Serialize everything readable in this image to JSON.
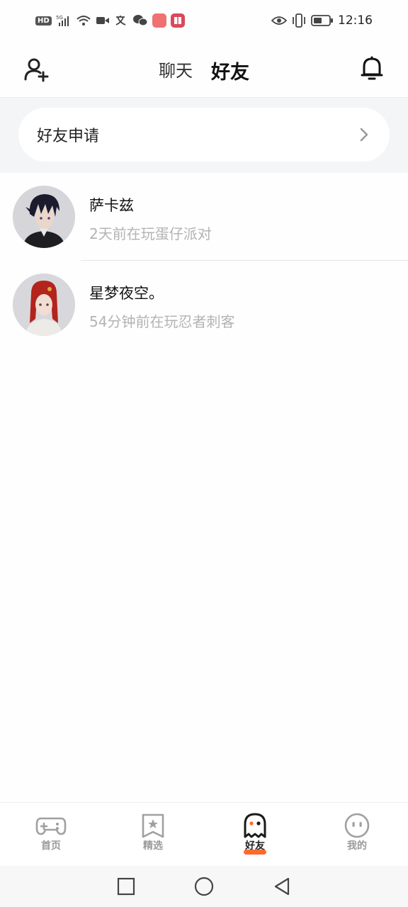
{
  "status_bar": {
    "hd": "HD",
    "signal": "5G",
    "time": "12:16",
    "icons": [
      "hd-icon",
      "signal-icon",
      "wifi-icon",
      "video-icon",
      "translate-icon",
      "wechat-icon",
      "app-icon-red",
      "app-icon-book",
      "eye-icon",
      "vibrate-icon",
      "battery-icon"
    ]
  },
  "header": {
    "tabs": [
      {
        "label": "聊天",
        "active": false
      },
      {
        "label": "好友",
        "active": true
      }
    ],
    "accent": "#ff5a1f"
  },
  "friend_request": {
    "label": "好友申请"
  },
  "friends": [
    {
      "name": "萨卡兹",
      "status": "2天前在玩蛋仔派对"
    },
    {
      "name": "星梦夜空。",
      "status": "54分钟前在玩忍者刺客"
    }
  ],
  "bottom_nav": {
    "items": [
      {
        "label": "首页",
        "icon": "gamepad-icon",
        "active": false
      },
      {
        "label": "精选",
        "icon": "star-bookmark-icon",
        "active": false
      },
      {
        "label": "好友",
        "icon": "ghost-icon",
        "active": true
      },
      {
        "label": "我的",
        "icon": "face-icon",
        "active": false
      }
    ]
  }
}
